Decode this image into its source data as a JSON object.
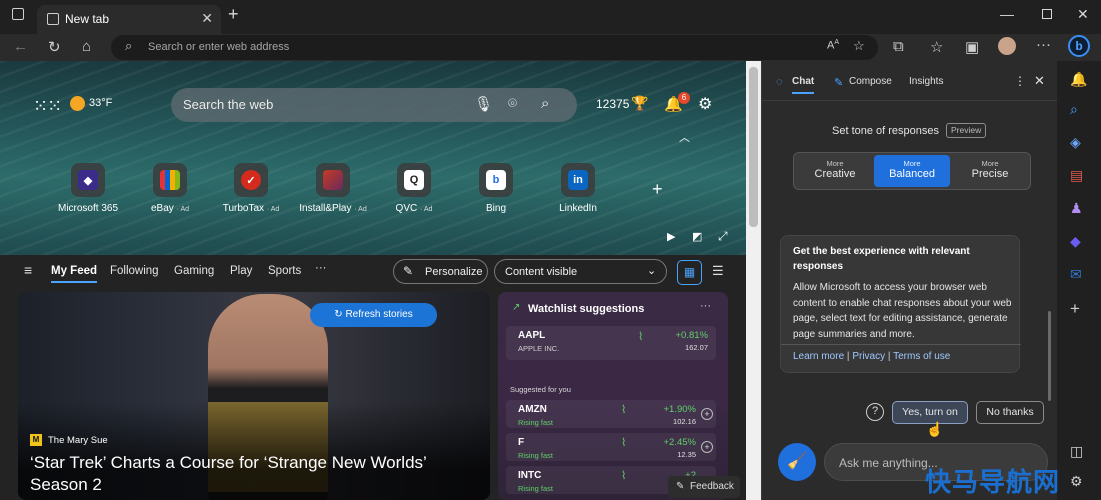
{
  "browser": {
    "tab_title": "New tab",
    "address_placeholder": "Search or enter web address"
  },
  "hero": {
    "weather": "33°F",
    "search_placeholder": "Search the web",
    "rewards_points": "12375",
    "notifications_count": "6"
  },
  "quick_links": [
    {
      "name": "Microsoft 365",
      "ad": "",
      "color": "#3b2b8a"
    },
    {
      "name": "eBay",
      "ad": "· Ad",
      "color": "#e53238"
    },
    {
      "name": "TurboTax",
      "ad": "· Ad",
      "color": "#d52b1e"
    },
    {
      "name": "Install&Play",
      "ad": "· Ad",
      "color": "#c63b24"
    },
    {
      "name": "QVC",
      "ad": "· Ad",
      "color": "#ffffff"
    },
    {
      "name": "Bing",
      "ad": "",
      "color": "#ffffff"
    },
    {
      "name": "LinkedIn",
      "ad": "",
      "color": "#0a66c2"
    }
  ],
  "feed_nav": {
    "items": [
      "My Feed",
      "Following",
      "Gaming",
      "Play",
      "Sports"
    ],
    "more": "···",
    "personalize": "Personalize",
    "content_visible": "Content visible"
  },
  "story": {
    "refresh": "Refresh stories",
    "source": "The Mary Sue",
    "headline": "‘Star Trek’ Charts a Course for ‘Strange New Worlds’ Season 2"
  },
  "watchlist": {
    "title": "Watchlist suggestions",
    "suggested_label": "Suggested for you",
    "top": {
      "symbol": "AAPL",
      "name": "APPLE INC.",
      "change": "+0.81%",
      "price": "162.07"
    },
    "suggested": [
      {
        "symbol": "AMZN",
        "status": "Rising fast",
        "change": "+1.90%",
        "price": "102.16"
      },
      {
        "symbol": "F",
        "status": "Rising fast",
        "change": "+2.45%",
        "price": "12.35"
      },
      {
        "symbol": "INTC",
        "status": "Rising fast",
        "change": "+2",
        "price": ""
      }
    ]
  },
  "feedback": "Feedback",
  "sidepane": {
    "tabs": [
      "Chat",
      "Compose",
      "Insights"
    ],
    "tone_label": "Set tone of responses",
    "preview": "Preview",
    "tones": [
      {
        "more": "More",
        "name": "Creative"
      },
      {
        "more": "More",
        "name": "Balanced"
      },
      {
        "more": "More",
        "name": "Precise"
      }
    ],
    "selected_tone": "Balanced",
    "card_heading": "Get the best experience with relevant responses",
    "card_body": "Allow Microsoft to access your browser web content to enable chat responses about your web page, select text for editing assistance, generate page summaries and more.",
    "learn_more": "Learn more",
    "privacy": "Privacy",
    "terms": "Terms of use",
    "yes": "Yes, turn on",
    "no": "No thanks",
    "ask_placeholder": "Ask me anything..."
  },
  "watermark": "快马导航网"
}
